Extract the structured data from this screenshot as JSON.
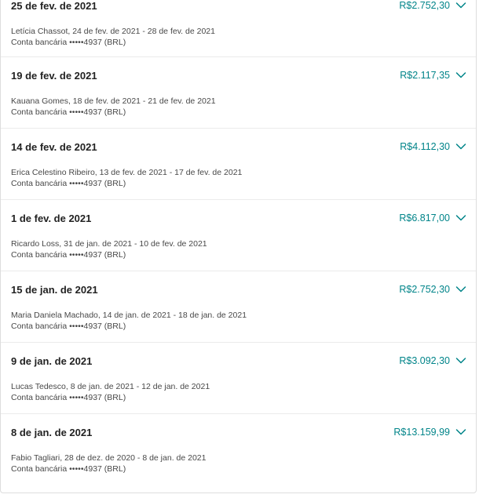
{
  "payouts": [
    {
      "date": "25 de fev. de 2021",
      "amount": "R$2.752,30",
      "guest_line": "Letícia Chassot, 24 de fev. de 2021 - 28 de fev. de 2021",
      "account_line": "Conta bancária •••••4937 (BRL)",
      "expand_icon": "chevron-down-icon"
    },
    {
      "date": "19 de fev. de 2021",
      "amount": "R$2.117,35",
      "guest_line": "Kauana Gomes, 18 de fev. de 2021 - 21 de fev. de 2021",
      "account_line": "Conta bancária •••••4937 (BRL)",
      "expand_icon": "chevron-down-icon"
    },
    {
      "date": "14 de fev. de 2021",
      "amount": "R$4.112,30",
      "guest_line": "Erica Celestino Ribeiro, 13 de fev. de 2021 - 17 de fev. de 2021",
      "account_line": "Conta bancária •••••4937 (BRL)",
      "expand_icon": "chevron-down-icon"
    },
    {
      "date": "1 de fev. de 2021",
      "amount": "R$6.817,00",
      "guest_line": "Ricardo Loss, 31 de jan. de 2021 - 10 de fev. de 2021",
      "account_line": "Conta bancária •••••4937 (BRL)",
      "expand_icon": "chevron-down-icon"
    },
    {
      "date": "15 de jan. de 2021",
      "amount": "R$2.752,30",
      "guest_line": "Maria Daniela Machado, 14 de jan. de 2021 - 18 de jan. de 2021",
      "account_line": "Conta bancária •••••4937 (BRL)",
      "expand_icon": "chevron-down-icon"
    },
    {
      "date": "9 de jan. de 2021",
      "amount": "R$3.092,30",
      "guest_line": "Lucas Tedesco, 8 de jan. de 2021 - 12 de jan. de 2021",
      "account_line": "Conta bancária •••••4937 (BRL)",
      "expand_icon": "chevron-down-icon"
    },
    {
      "date": "8 de jan. de 2021",
      "amount": "R$13.159,99",
      "guest_line": "Fabio Tagliari, 28 de dez. de 2020 - 8 de jan. de 2021",
      "account_line": "Conta bancária •••••4937 (BRL)",
      "expand_icon": "chevron-down-icon"
    }
  ],
  "colors": {
    "accent": "#008489",
    "text_primary": "#222222",
    "text_secondary": "#484848",
    "divider": "#ebebeb"
  }
}
